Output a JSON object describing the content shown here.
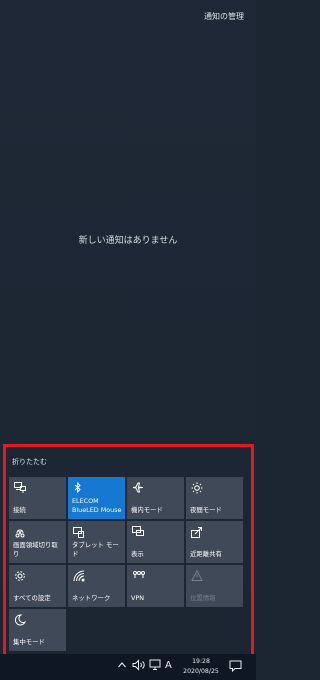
{
  "header": {
    "manage_notifications": "通知の管理"
  },
  "notifications": {
    "empty_message": "新しい通知はありません"
  },
  "quick_actions": {
    "collapse_label": "折りたたむ",
    "tiles": [
      {
        "label": "接続",
        "icon": "connect-icon",
        "state": "off"
      },
      {
        "label": "ELECOM\nBlueLED Mouse",
        "icon": "bluetooth-icon",
        "state": "on"
      },
      {
        "label": "機内モード",
        "icon": "airplane-icon",
        "state": "off"
      },
      {
        "label": "夜間モード",
        "icon": "brightness-icon",
        "state": "off"
      },
      {
        "label": "画面領域切り取り",
        "icon": "snip-icon",
        "state": "off"
      },
      {
        "label": "タブレット モード",
        "icon": "tablet-icon",
        "state": "off"
      },
      {
        "label": "表示",
        "icon": "project-icon",
        "state": "off"
      },
      {
        "label": "近距離共有",
        "icon": "share-icon",
        "state": "off"
      },
      {
        "label": "すべての設定",
        "icon": "gear-icon",
        "state": "off"
      },
      {
        "label": "ネットワーク",
        "icon": "network-icon",
        "state": "off"
      },
      {
        "label": "VPN",
        "icon": "vpn-icon",
        "state": "off"
      },
      {
        "label": "位置情報",
        "icon": "location-icon",
        "state": "disabled"
      },
      {
        "label": "集中モード",
        "icon": "moon-icon",
        "state": "off"
      }
    ]
  },
  "taskbar": {
    "time": "19:28",
    "date": "2020/08/25",
    "ime_indicator": "A"
  },
  "colors": {
    "background": "#1c2633",
    "tile": "#3f4957",
    "tile_active": "#1778d2",
    "highlight_frame": "#e3191f",
    "taskbar": "#0f1722"
  }
}
